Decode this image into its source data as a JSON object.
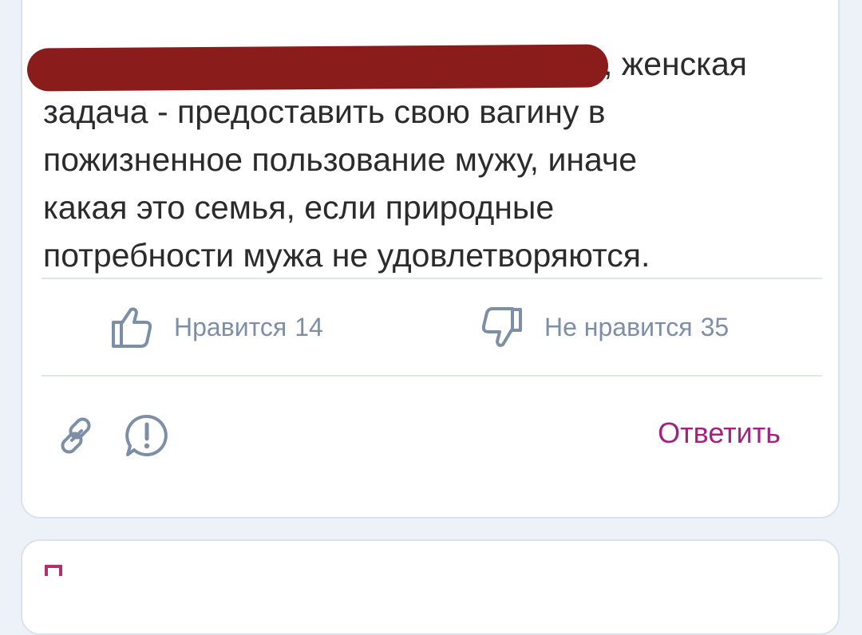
{
  "comment": {
    "text_line1": ", женская",
    "text_rest": "задача - предоставить свою вагину в\nпожизненное пользование мужу, иначе\nкакая это семья, если природные\nпотребности мужа не удовлетворяются."
  },
  "reactions": {
    "like_label": "Нравится",
    "like_count": "14",
    "dislike_label": "Не нравится",
    "dislike_count": "35"
  },
  "actions": {
    "reply_label": "Ответить",
    "link_icon": "link-icon",
    "report_icon": "report-icon"
  },
  "colors": {
    "accent_reply": "#a2237e",
    "reaction_text": "#7d8fa6",
    "redaction": "#8a1c1c"
  }
}
